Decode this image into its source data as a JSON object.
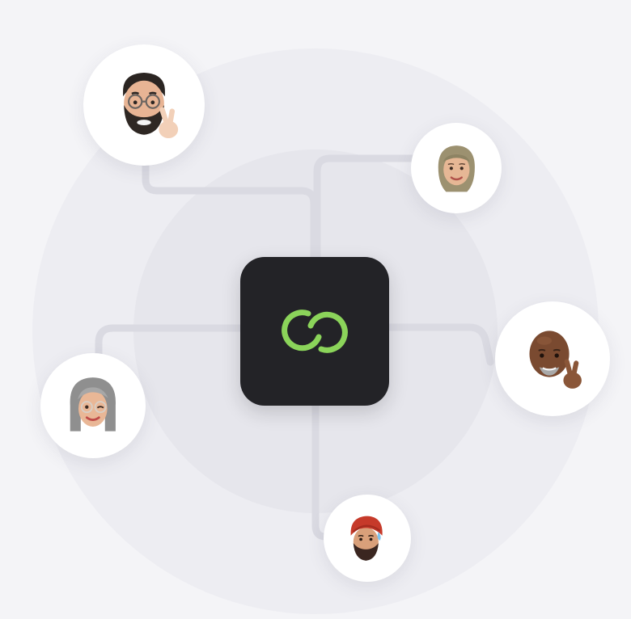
{
  "diagram": {
    "background": "#f4f4f7",
    "connector_color": "#d9d9e1",
    "hub": {
      "icon": "interlocking-rings-logo-icon",
      "background": "#232327",
      "accent": "#8bd45a"
    },
    "participants": [
      {
        "icon": "memoji-bearded-man-glasses-peace-icon"
      },
      {
        "icon": "memoji-woman-hijab-icon"
      },
      {
        "icon": "memoji-bald-man-peace-icon"
      },
      {
        "icon": "memoji-gray-haired-woman-wink-icon"
      },
      {
        "icon": "memoji-man-red-turban-icon"
      }
    ]
  }
}
